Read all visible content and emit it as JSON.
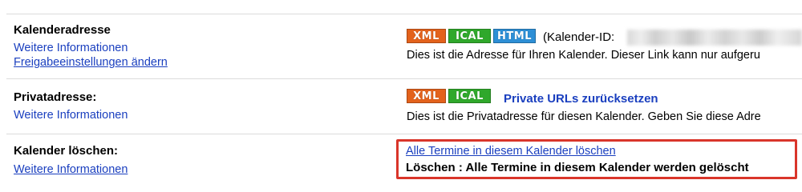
{
  "rows": {
    "calendar_address": {
      "label": "Kalenderadresse",
      "link1": "Weitere Informationen",
      "link2": "Freigabeeinstellungen ändern",
      "badges": [
        "XML",
        "ICAL",
        "HTML"
      ],
      "id_prefix": "(Kalender-ID:",
      "description": "Dies ist die Adresse für Ihren Kalender. Dieser Link kann nur aufgeru"
    },
    "private_address": {
      "label": "Privatadresse:",
      "link1": "Weitere Informationen",
      "badges": [
        "XML",
        "ICAL"
      ],
      "reset_link": "Private URLs zurücksetzen",
      "description": "Dies ist die Privatadresse für diesen Kalender. Geben Sie diese Adre"
    },
    "delete_calendar": {
      "label": "Kalender löschen:",
      "link1": "Weitere Informationen",
      "delete_link": "Alle Termine in diesem Kalender löschen",
      "warning": "Löschen : Alle Termine in diesem Kalender werden gelöscht"
    }
  },
  "colors": {
    "link": "#1a3fbf",
    "xml_badge": "#e3621c",
    "ical_badge": "#2fa82b",
    "html_badge": "#2d8fd6",
    "highlight_border": "#d9352a"
  }
}
